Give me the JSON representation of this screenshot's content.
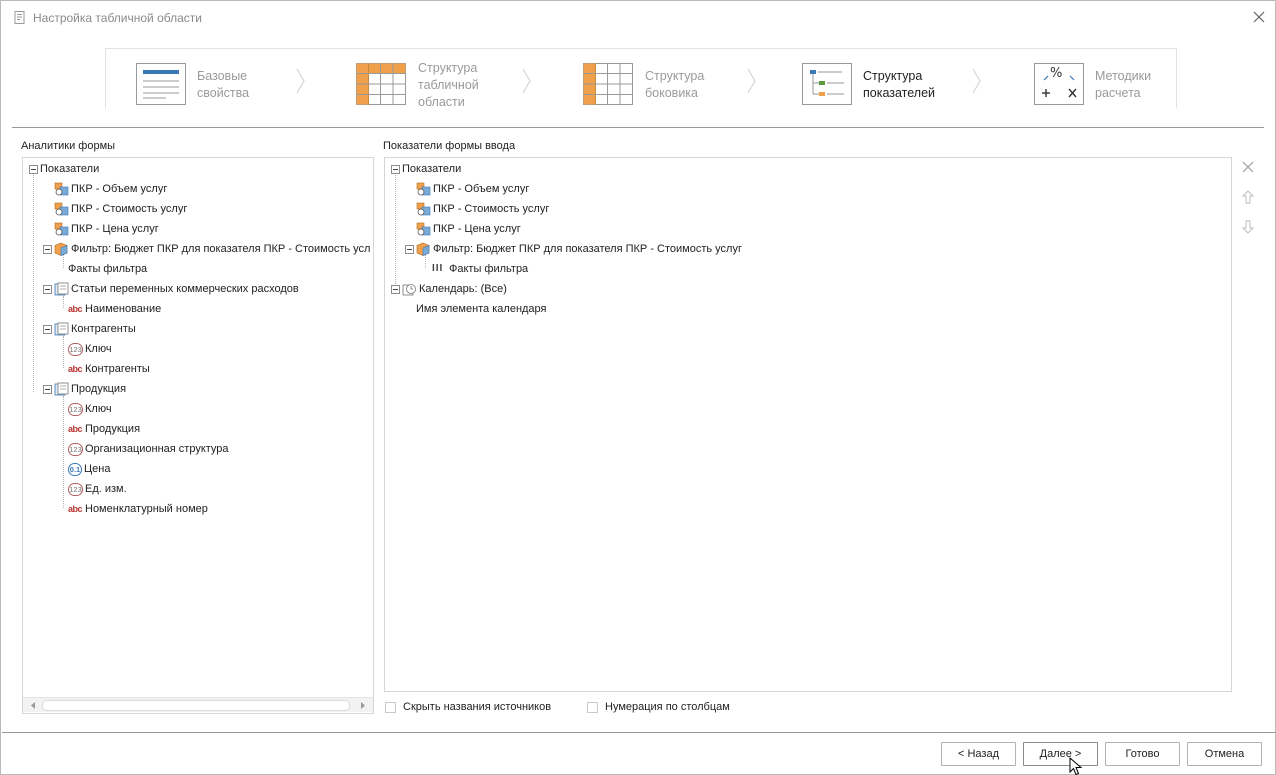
{
  "window": {
    "title": "Настройка табличной области"
  },
  "steps": [
    {
      "label_lines": [
        "Базовые",
        "свойства"
      ],
      "icon": "form-icon",
      "active": false
    },
    {
      "label_lines": [
        "Структура",
        "табличной",
        "области"
      ],
      "icon": "table-grid-icon",
      "active": false
    },
    {
      "label_lines": [
        "Структура",
        "боковика"
      ],
      "icon": "sidebar-grid-icon",
      "active": false
    },
    {
      "label_lines": [
        "Структура",
        "показателей"
      ],
      "icon": "hierarchy-icon",
      "active": true
    },
    {
      "label_lines": [
        "Методики",
        "расчета"
      ],
      "icon": "math-operations-icon",
      "active": false
    }
  ],
  "left_panel": {
    "label": "Аналитики формы",
    "root": "Показатели",
    "items": [
      {
        "text": "ПКР - Объем услуг",
        "icon": "indicator-icon"
      },
      {
        "text": "ПКР - Стоимость услуг",
        "icon": "indicator-icon"
      },
      {
        "text": "ПКР - Цена услуг",
        "icon": "indicator-icon"
      },
      {
        "text": "Фильтр: Бюджет ПКР для показателя ПКР - Стоимость усл",
        "icon": "cube-icon"
      },
      {
        "text": "Факты фильтра",
        "icon": ""
      },
      {
        "text": "Статьи переменных коммерческих расходов",
        "icon": "dictionary-icon"
      },
      {
        "text": "Наименование",
        "icon": "abc-icon"
      },
      {
        "text": "Контрагенты",
        "icon": "dictionary-icon"
      },
      {
        "text": "Ключ",
        "icon": "number-icon"
      },
      {
        "text": "Контрагенты",
        "icon": "abc-icon"
      },
      {
        "text": "Продукция",
        "icon": "dictionary-icon"
      },
      {
        "text": "Ключ",
        "icon": "number-icon"
      },
      {
        "text": "Продукция",
        "icon": "abc-icon"
      },
      {
        "text": "Организационная структура",
        "icon": "number-icon"
      },
      {
        "text": "Цена",
        "icon": "decimal-icon"
      },
      {
        "text": "Ед. изм.",
        "icon": "number-icon"
      },
      {
        "text": "Номенклатурный номер",
        "icon": "abc-icon"
      }
    ]
  },
  "right_panel": {
    "label": "Показатели формы ввода",
    "root": "Показатели",
    "items": [
      {
        "text": "ПКР - Объем услуг",
        "icon": "indicator-icon"
      },
      {
        "text": "ПКР - Стоимость услуг",
        "icon": "indicator-icon"
      },
      {
        "text": "ПКР - Цена услуг",
        "icon": "indicator-icon"
      },
      {
        "text": "Фильтр: Бюджет ПКР для показателя ПКР - Стоимость услуг",
        "icon": "cube-icon"
      },
      {
        "text": "Факты фильтра",
        "icon": "facts-icon",
        "icon_text": "III"
      },
      {
        "text": "Календарь: (Все)",
        "icon": "calendar-icon"
      },
      {
        "text": "Имя элемента календаря",
        "icon": ""
      }
    ]
  },
  "icon_glyphs": {
    "abc": "abc",
    "number": "123",
    "decimal": "0.1"
  },
  "options": {
    "hide_source_names": "Скрыть названия источников",
    "column_numbering": "Нумерация по столбцам"
  },
  "buttons": {
    "back": "< Назад",
    "next": "Далее >",
    "done": "Готово",
    "cancel": "Отмена"
  },
  "colors": {
    "accent_orange": "#f0a04a",
    "accent_blue": "#3a78b8",
    "text_muted": "#9a9a9a"
  }
}
